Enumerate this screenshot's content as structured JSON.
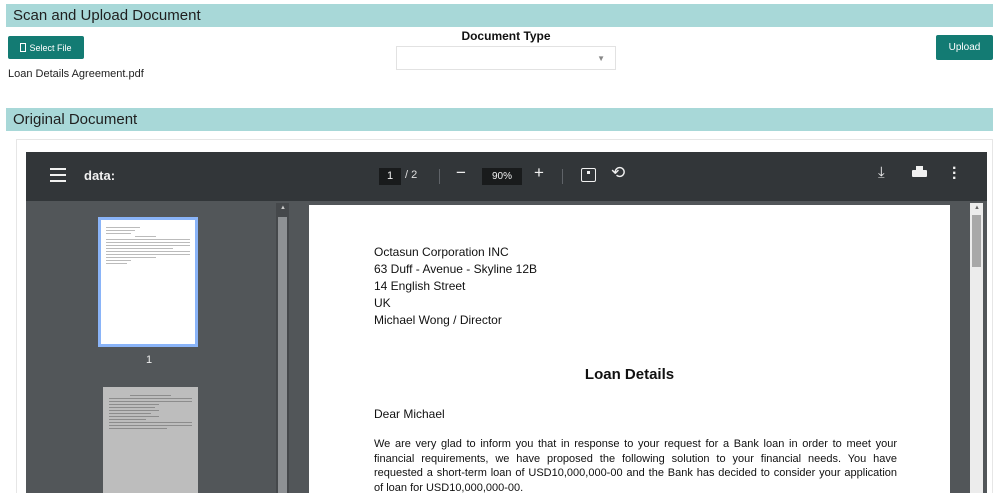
{
  "scan_section": {
    "title": "Scan and Upload Document"
  },
  "select_file_button": {
    "label": "Select File"
  },
  "document_type": {
    "label": "Document Type",
    "value": ""
  },
  "upload_button": {
    "label": "Upload"
  },
  "uploaded_file": {
    "name": "Loan Details Agreement.pdf"
  },
  "original_section": {
    "title": "Original Document"
  },
  "viewer": {
    "title": "data:",
    "current_page": "1",
    "total_pages": "/ 2",
    "zoom": "90%",
    "thumbnail_label": "1",
    "icons": [
      "menu-icon",
      "zoom-out-icon",
      "zoom-in-icon",
      "fit-page-icon",
      "rotate-icon",
      "download-icon",
      "print-icon",
      "more-icon"
    ]
  },
  "document": {
    "address_lines": [
      "Octasun Corporation INC",
      "63 Duff - Avenue - Skyline 12B",
      "14 English Street",
      "UK",
      "Michael Wong / Director"
    ],
    "heading": "Loan Details",
    "greeting": "Dear Michael",
    "body": "We are very glad to inform you that in response to your request for a Bank loan in order to meet your financial requirements, we have proposed the following solution to your financial needs. You have requested a short-term loan of USD10,000,000-00 and the Bank has decided to consider your application of loan for USD10,000,000-00."
  },
  "colors": {
    "section_bar": "#a8d8d8",
    "button": "#137b73",
    "toolbar": "#323639",
    "viewer_bg": "#525659"
  }
}
